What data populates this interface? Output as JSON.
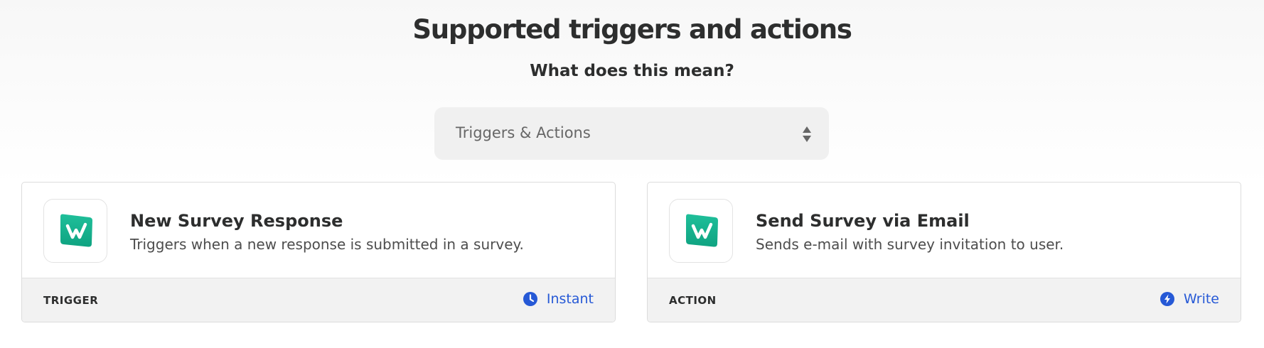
{
  "header": {
    "title": "Supported triggers and actions",
    "subtitle": "What does this mean?"
  },
  "filter": {
    "selected": "Triggers & Actions"
  },
  "colors": {
    "accent": "#2659d6",
    "app_icon": "#17b08f"
  },
  "cards": [
    {
      "app_icon": "survey-app-icon",
      "title": "New Survey Response",
      "description": "Triggers when a new response is submitted in a survey.",
      "type": "TRIGGER",
      "mode_icon": "clock-icon",
      "mode": "Instant"
    },
    {
      "app_icon": "survey-app-icon",
      "title": "Send Survey via Email",
      "description": "Sends e-mail with survey invitation to user.",
      "type": "ACTION",
      "mode_icon": "bolt-icon",
      "mode": "Write"
    }
  ]
}
